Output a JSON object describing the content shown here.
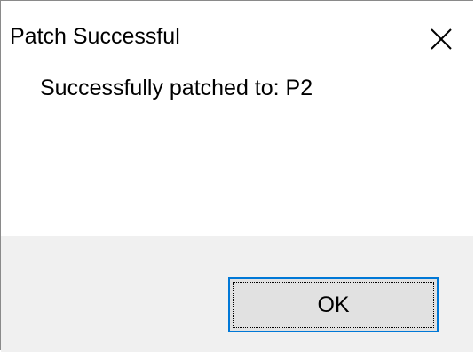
{
  "dialog": {
    "title": "Patch Successful",
    "close_icon": "close-icon",
    "message": "Successfully patched to: P2",
    "ok_label": "OK"
  },
  "colors": {
    "content_background": "#ffffff",
    "footer_background": "#f0f0f0",
    "button_background": "#e1e1e1",
    "button_border": "#0078d7",
    "text": "#000000"
  }
}
